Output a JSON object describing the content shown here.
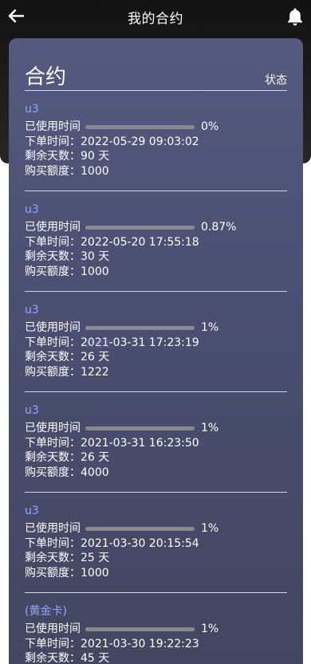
{
  "nav": {
    "title": "我的合约"
  },
  "card": {
    "title": "合约",
    "status_label": "状态"
  },
  "labels": {
    "used_time": "已使用时间",
    "order_time": "下单时间：",
    "remaining_days": "剩余天数：",
    "purchase_amount": "购买额度："
  },
  "contracts": [
    {
      "name": "u3",
      "progress": "0%",
      "progress_fraction": 0.0,
      "order_time": "2022-05-29 09:03:02",
      "remaining_days": "90 天",
      "amount": "1000"
    },
    {
      "name": "u3",
      "progress": "0.87%",
      "progress_fraction": 0.0087,
      "order_time": "2022-05-20 17:55:18",
      "remaining_days": "30 天",
      "amount": "1000"
    },
    {
      "name": "u3",
      "progress": "1%",
      "progress_fraction": 0.01,
      "order_time": "2021-03-31 17:23:19",
      "remaining_days": "26 天",
      "amount": "1222"
    },
    {
      "name": "u3",
      "progress": "1%",
      "progress_fraction": 0.01,
      "order_time": "2021-03-31 16:23:50",
      "remaining_days": "26 天",
      "amount": "4000"
    },
    {
      "name": "u3",
      "progress": "1%",
      "progress_fraction": 0.01,
      "order_time": "2021-03-30 20:15:54",
      "remaining_days": "25 天",
      "amount": "1000"
    },
    {
      "name": "(黄金卡)",
      "progress": "1%",
      "progress_fraction": 0.01,
      "order_time": "2021-03-30 19:22:23",
      "remaining_days": "45 天",
      "amount": ""
    }
  ],
  "colors": {
    "accent_name": "#8fa6ff",
    "progress_fill": "#6fcf6f",
    "progress_track": "#8a8a8e"
  },
  "icons": {
    "back": "arrow-left-icon",
    "notifications": "bell-icon"
  }
}
